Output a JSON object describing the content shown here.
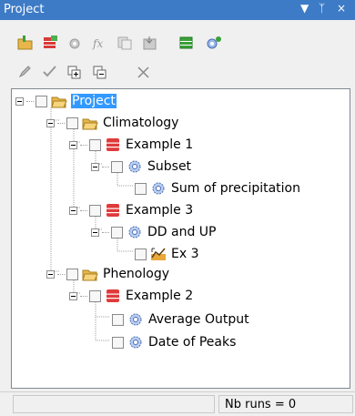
{
  "window": {
    "title": "Project",
    "menu_glyph": "▼",
    "pin_glyph": "ᛉ",
    "close_glyph": "×"
  },
  "toolbar1": [
    "open-folder-icon",
    "add-dataset-icon",
    "gear-add-icon",
    "function-icon",
    "copy-icon",
    "import-icon",
    "export-icon",
    "run-icon"
  ],
  "toolbar2": [
    "edit-icon",
    "check-icon",
    "expand-all-icon",
    "collapse-all-icon",
    "delete-icon"
  ],
  "tree": [
    {
      "id": "project",
      "label": "Project",
      "icon": "folder-open-icon",
      "level": 0,
      "selected": true
    },
    {
      "id": "climatology",
      "label": "Climatology",
      "icon": "folder-open-icon",
      "level": 1
    },
    {
      "id": "example1",
      "label": "Example 1",
      "icon": "dataset-icon",
      "level": 2
    },
    {
      "id": "subset",
      "label": "Subset",
      "icon": "gear-icon",
      "level": 3
    },
    {
      "id": "sum-precip",
      "label": "Sum of precipitation",
      "icon": "gear-icon",
      "level": 4
    },
    {
      "id": "example3",
      "label": "Example 3",
      "icon": "dataset-icon",
      "level": 2
    },
    {
      "id": "dd-up",
      "label": "DD and UP",
      "icon": "gear-icon",
      "level": 3
    },
    {
      "id": "ex3",
      "label": "Ex 3",
      "icon": "chart-icon",
      "level": 4
    },
    {
      "id": "phenology",
      "label": "Phenology",
      "icon": "folder-open-icon",
      "level": 1
    },
    {
      "id": "example2",
      "label": "Example 2",
      "icon": "dataset-icon",
      "level": 2
    },
    {
      "id": "avg-output",
      "label": "Average Output",
      "icon": "gear-icon",
      "level": 3
    },
    {
      "id": "date-peaks",
      "label": "Date of Peaks",
      "icon": "gear-icon",
      "level": 3
    }
  ],
  "status": {
    "runs": "Nb runs = 0"
  },
  "colors": {
    "titlebar": "#3d7bc6",
    "selection": "#3399ff"
  }
}
